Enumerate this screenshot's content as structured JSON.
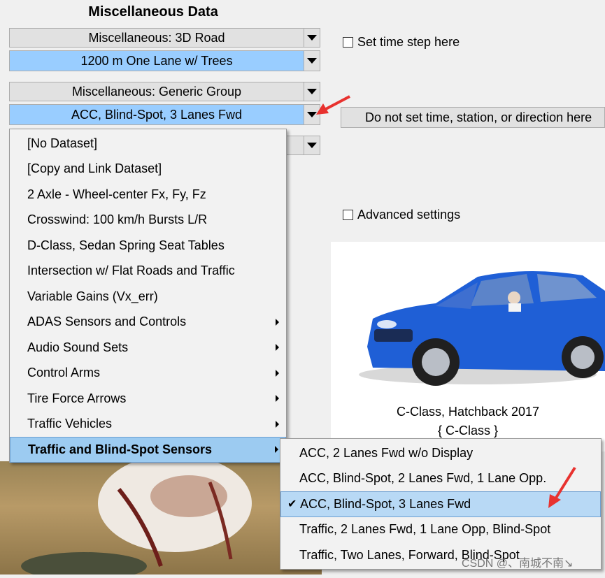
{
  "section_title": "Miscellaneous Data",
  "dropdowns": {
    "road_category": "Miscellaneous: 3D Road",
    "road_value": "1200 m One Lane w/ Trees",
    "group_category": "Miscellaneous: Generic Group",
    "group_value": "ACC, Blind-Spot, 3 Lanes Fwd"
  },
  "checkboxes": {
    "time_step": "Set time step here",
    "advanced": "Advanced settings"
  },
  "time_station_button": "Do not set time, station, or direction here",
  "vehicle": {
    "name": "C-Class, Hatchback 2017",
    "code": "{ C-Class }"
  },
  "menu": {
    "items": [
      {
        "label": "[No Dataset]",
        "submenu": false
      },
      {
        "label": "[Copy and Link Dataset]",
        "submenu": false
      },
      {
        "label": "2 Axle - Wheel-center Fx, Fy, Fz",
        "submenu": false
      },
      {
        "label": "Crosswind: 100 km/h Bursts L/R",
        "submenu": false
      },
      {
        "label": "D-Class, Sedan Spring Seat Tables",
        "submenu": false
      },
      {
        "label": "Intersection w/ Flat Roads and Traffic",
        "submenu": false
      },
      {
        "label": "Variable Gains (Vx_err)",
        "submenu": false
      },
      {
        "label": "ADAS Sensors and Controls",
        "submenu": true
      },
      {
        "label": "Audio Sound Sets",
        "submenu": true
      },
      {
        "label": "Control Arms",
        "submenu": true
      },
      {
        "label": "Tire Force Arrows",
        "submenu": true
      },
      {
        "label": "Traffic Vehicles",
        "submenu": true
      },
      {
        "label": "Traffic and Blind-Spot Sensors",
        "submenu": true,
        "highlighted": true
      }
    ]
  },
  "submenu": {
    "items": [
      {
        "label": "ACC, 2 Lanes Fwd w/o Display"
      },
      {
        "label": "ACC, Blind-Spot, 2 Lanes Fwd, 1 Lane Opp."
      },
      {
        "label": "ACC, Blind-Spot, 3 Lanes Fwd",
        "checked": true
      },
      {
        "label": "Traffic, 2 Lanes Fwd, 1 Lane Opp, Blind-Spot"
      },
      {
        "label": "Traffic, Two Lanes, Forward, Blind-Spot"
      }
    ]
  },
  "watermark": "CSDN @、南城不南↘",
  "colors": {
    "selected_field": "#99cdff",
    "menu_highlight": "#9ccbf1",
    "arrow_annotation": "#e8322f",
    "car_body": "#1f5fd6"
  }
}
